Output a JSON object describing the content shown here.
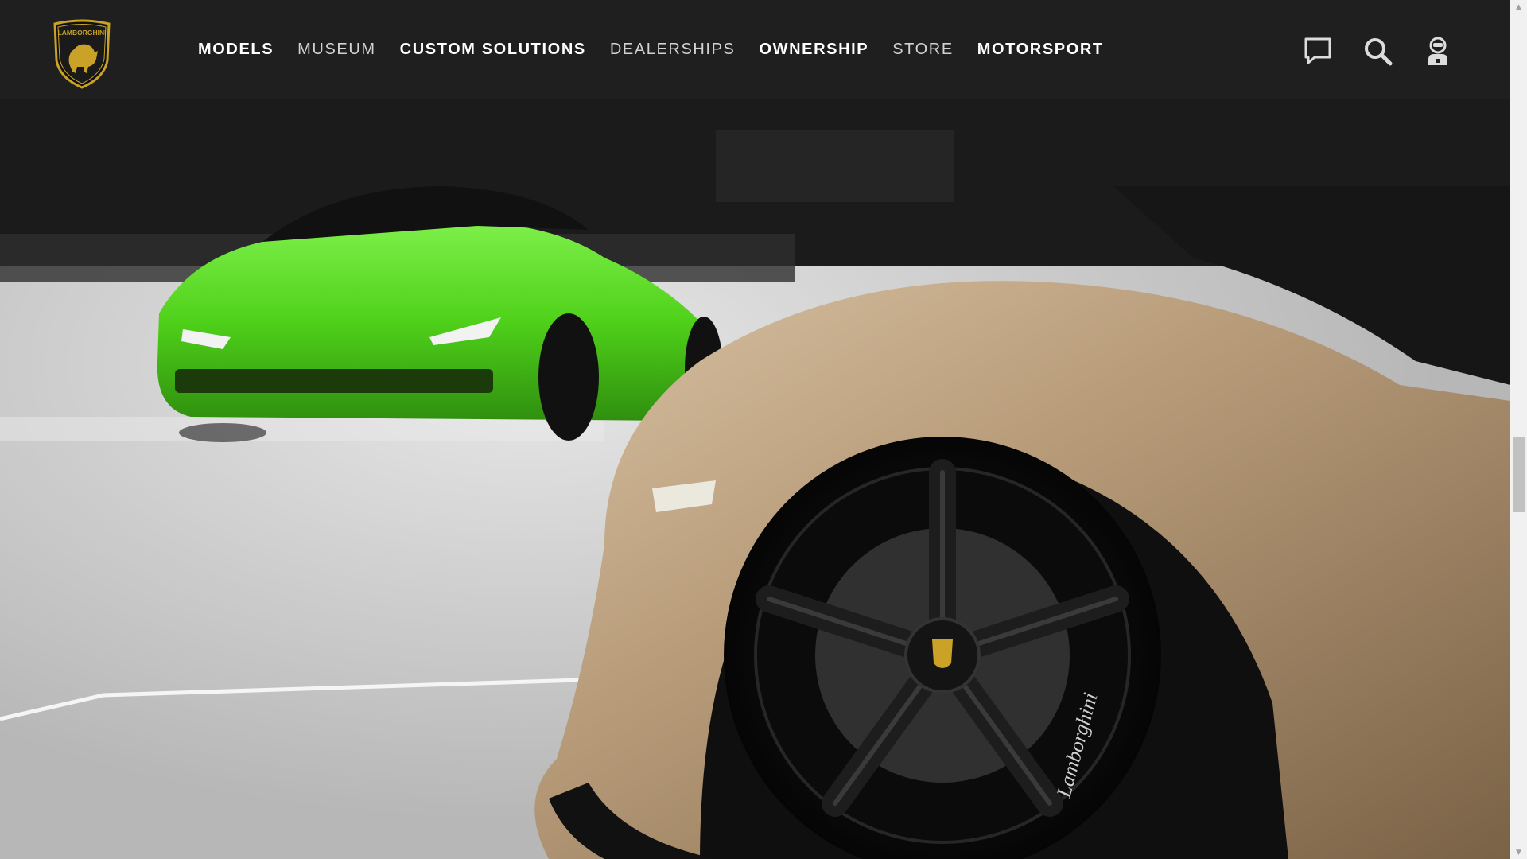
{
  "header": {
    "logo_text": "LAMBORGHINI",
    "nav": [
      {
        "label": "MODELS"
      },
      {
        "label": "MUSEUM"
      },
      {
        "label": "CUSTOM SOLUTIONS"
      },
      {
        "label": "DEALERSHIPS"
      },
      {
        "label": "OWNERSHIP"
      },
      {
        "label": "STORE"
      },
      {
        "label": "MOTORSPORT"
      }
    ],
    "icons": [
      "chat-icon",
      "search-icon",
      "account-icon"
    ]
  },
  "hero": {
    "image": "showroom-cars-photo",
    "wheel_badge_text": "Lamborghini"
  },
  "colors": {
    "header_bg": "#1f1f1f",
    "nav_text": "#ffffff",
    "nav_text_light": "#d2d2d2",
    "logo_gold": "#c9a227",
    "car_green": "#4fd11a",
    "car_bronze": "#b89c7a"
  }
}
